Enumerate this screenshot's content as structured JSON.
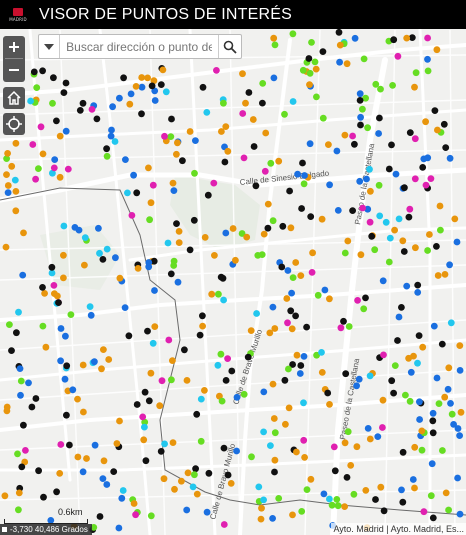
{
  "app": {
    "title": "VISOR DE PUNTOS DE INTERÉS",
    "logo_text": "MADRID"
  },
  "search": {
    "placeholder": "Buscar dirección o punto de interés"
  },
  "map": {
    "streets": [
      {
        "name": "Calle de Sinesio Delgado"
      },
      {
        "name": "Paseo de la Castellana"
      },
      {
        "name": "Paseo de la Castellana"
      },
      {
        "name": "Calle de Bravo Murillo"
      },
      {
        "name": "Calle de Bravo Murillo"
      }
    ],
    "poi_colors": {
      "black": "#111111",
      "orange": "#e8950c",
      "green": "#66dd22",
      "blue": "#1a6fe0",
      "cyan": "#22c7ee",
      "magenta": "#e020b0"
    },
    "scale_label": "0.6km",
    "coordinates": "-3,730 40,486 Grados",
    "attribution": "Ayto. Madrid | Ayto. Madrid, Es..."
  },
  "icons": {
    "zoom_in": "plus-icon",
    "zoom_out": "minus-icon",
    "home": "home-icon",
    "locate": "locate-icon",
    "search": "search-icon",
    "dropdown": "chevron-down-icon"
  }
}
